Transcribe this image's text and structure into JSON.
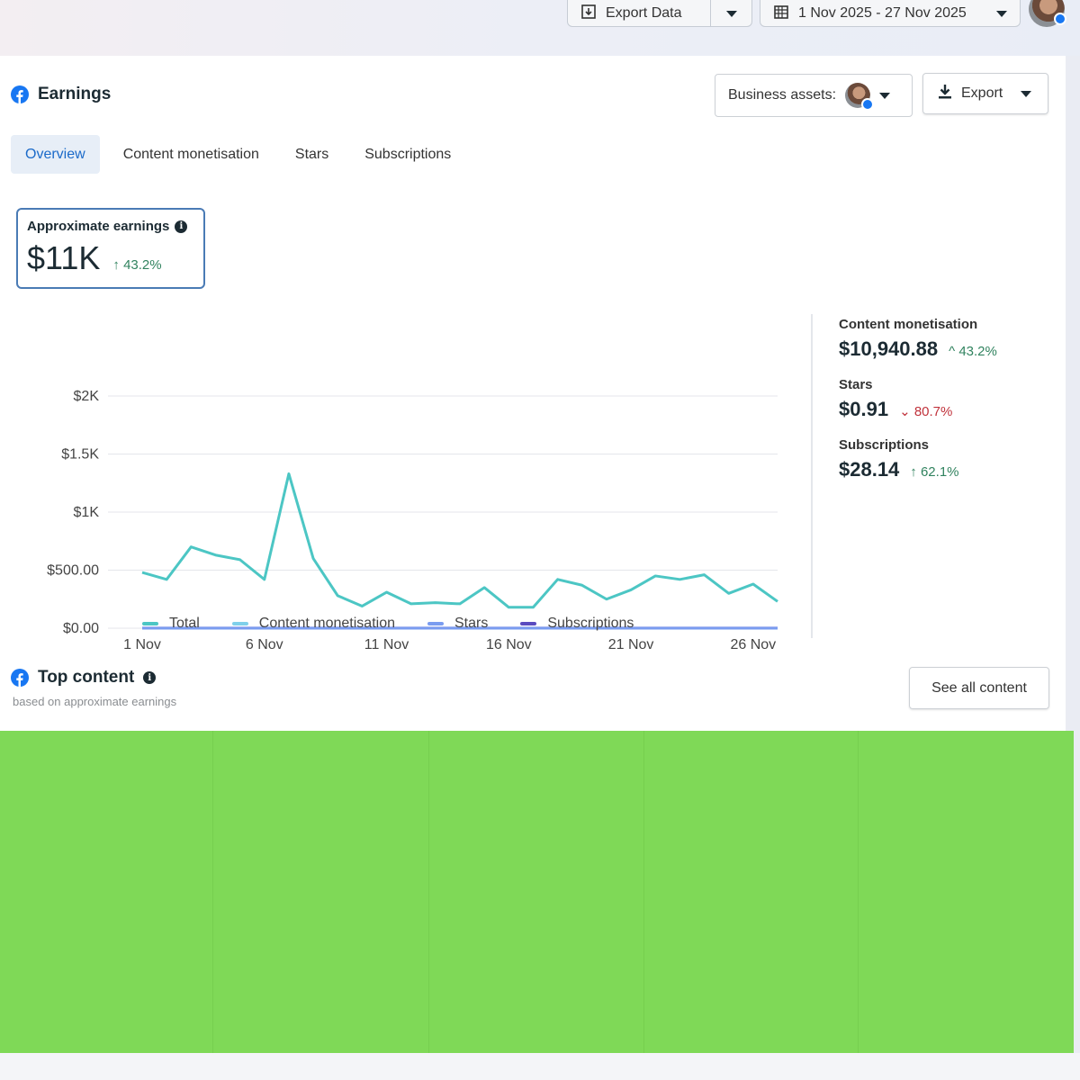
{
  "topbar": {
    "export_data_label": "Export Data",
    "date_range": "1 Nov 2025 - 27 Nov 2025"
  },
  "earnings": {
    "title": "Earnings",
    "business_assets_label": "Business assets:",
    "export_label": "Export",
    "tabs": [
      {
        "label": "Overview",
        "active": true
      },
      {
        "label": "Content monetisation",
        "active": false
      },
      {
        "label": "Stars",
        "active": false
      },
      {
        "label": "Subscriptions",
        "active": false
      }
    ],
    "approx": {
      "label": "Approximate earnings",
      "value": "$11K",
      "change": "43.2%",
      "change_arrow": "↑"
    }
  },
  "breakdown": [
    {
      "name": "Content monetisation",
      "amount": "$10,940.88",
      "arrow": "^",
      "pct": "43.2%",
      "dir": "up"
    },
    {
      "name": "Stars",
      "amount": "$0.91",
      "arrow": "⌄",
      "pct": "80.7%",
      "dir": "down"
    },
    {
      "name": "Subscriptions",
      "amount": "$28.14",
      "arrow": "↑",
      "pct": "62.1%",
      "dir": "up"
    }
  ],
  "legend": {
    "total": "Total",
    "content": "Content monetisation",
    "stars": "Stars",
    "subs": "Subscriptions"
  },
  "top_content": {
    "title": "Top content",
    "subtitle": "based on approximate earnings",
    "see_all_label": "See all content"
  },
  "colors": {
    "total": "#4cc6c4",
    "content": "#7fd0ea",
    "stars": "#7a9cf0",
    "subs": "#5a4bbf",
    "placeholder": "#7fd957"
  },
  "chart_data": {
    "type": "line",
    "x_tick_labels": [
      "1 Nov",
      "6 Nov",
      "11 Nov",
      "16 Nov",
      "21 Nov",
      "26 Nov"
    ],
    "y_tick_labels": [
      "$0.00",
      "$500.00",
      "$1K",
      "$1.5K",
      "$2K"
    ],
    "ylim": [
      0,
      2000
    ],
    "x": [
      1,
      2,
      3,
      4,
      5,
      6,
      7,
      8,
      9,
      10,
      11,
      12,
      13,
      14,
      15,
      16,
      17,
      18,
      19,
      20,
      21,
      22,
      23,
      24,
      25,
      26,
      27
    ],
    "series": [
      {
        "name": "Total",
        "values": [
          480,
          420,
          700,
          630,
          590,
          420,
          1330,
          600,
          280,
          190,
          310,
          210,
          220,
          210,
          350,
          180,
          180,
          420,
          370,
          250,
          330,
          450,
          420,
          460,
          300,
          380,
          230
        ]
      },
      {
        "name": "Stars",
        "values": [
          0,
          0,
          0,
          0,
          0,
          0,
          0,
          0,
          0,
          0,
          0,
          0,
          0,
          0,
          0,
          0,
          0,
          0,
          0,
          0,
          0,
          0,
          0,
          0,
          0,
          0,
          0
        ]
      },
      {
        "name": "Subscriptions",
        "values": [
          1,
          1,
          1,
          1,
          1,
          1,
          1,
          1,
          1,
          1,
          1,
          1,
          1,
          1,
          1,
          1,
          1,
          1,
          1,
          1,
          1,
          1,
          1,
          1,
          1,
          1,
          1
        ]
      }
    ],
    "grid": true,
    "legend_position": "bottom"
  }
}
